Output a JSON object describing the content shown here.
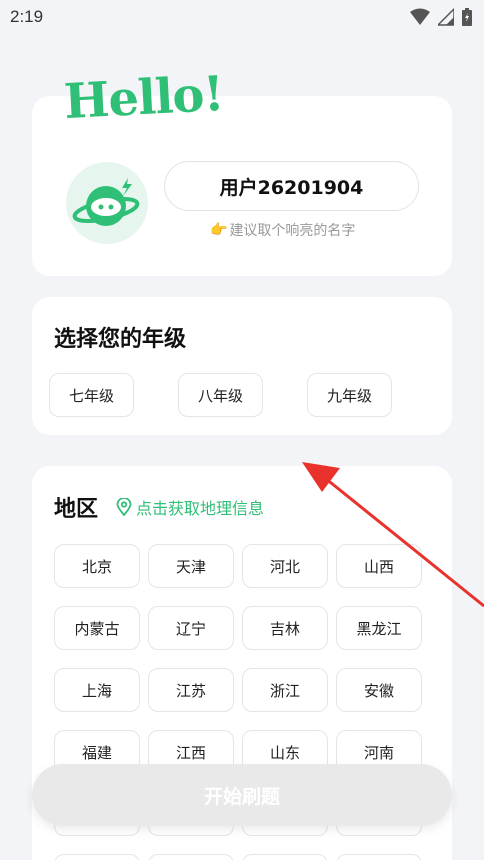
{
  "status": {
    "time": "2:19"
  },
  "hello": "Hello!",
  "profile": {
    "username": "用户26201904",
    "hint_emoji": "👉",
    "hint": "建议取个响亮的名字"
  },
  "grade": {
    "title": "选择您的年级",
    "options": [
      "七年级",
      "八年级",
      "九年级"
    ]
  },
  "region": {
    "title": "地区",
    "geo_link": "点击获取地理信息",
    "rows": [
      [
        "北京",
        "天津",
        "河北",
        "山西"
      ],
      [
        "内蒙古",
        "辽宁",
        "吉林",
        "黑龙江"
      ],
      [
        "上海",
        "江苏",
        "浙江",
        "安徽"
      ],
      [
        "福建",
        "江西",
        "山东",
        "河南"
      ]
    ]
  },
  "start_button": "开始刷题",
  "colors": {
    "accent": "#2fbf76",
    "arrow": "#e8322b",
    "background": "#f3f4f8"
  }
}
